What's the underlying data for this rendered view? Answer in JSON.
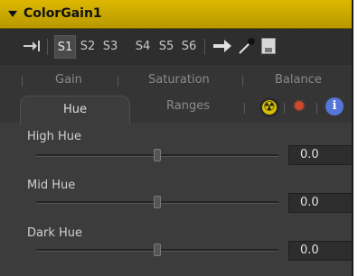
{
  "title_bar": {
    "title": "ColorGain1"
  },
  "toolbar": {
    "slots": [
      "S1",
      "S2",
      "S3",
      "S4",
      "S5",
      "S6"
    ],
    "active_slot": "S1"
  },
  "tabs": {
    "row1": [
      "Gain",
      "Saturation",
      "Balance"
    ],
    "row2": [
      "Hue",
      "Ranges"
    ],
    "active": "Hue"
  },
  "controls": [
    {
      "label": "High Hue",
      "value": "0.0",
      "slider_position": 0.5
    },
    {
      "label": "Mid Hue",
      "value": "0.0",
      "slider_position": 0.5
    },
    {
      "label": "Dark Hue",
      "value": "0.0",
      "slider_position": 0.5
    }
  ],
  "colors": {
    "title_bar": "#c9a800",
    "panel_bg": "#3c3c3c",
    "radio_icon": "#d8c000",
    "gear_icon": "#d04a2a",
    "info_icon": "#5575d8"
  },
  "icons": [
    "collapse-arrow-icon",
    "pin-icon",
    "arrow-right-icon",
    "color-picker-icon",
    "save-icon",
    "radioactive-icon",
    "gear-icon",
    "info-icon"
  ]
}
